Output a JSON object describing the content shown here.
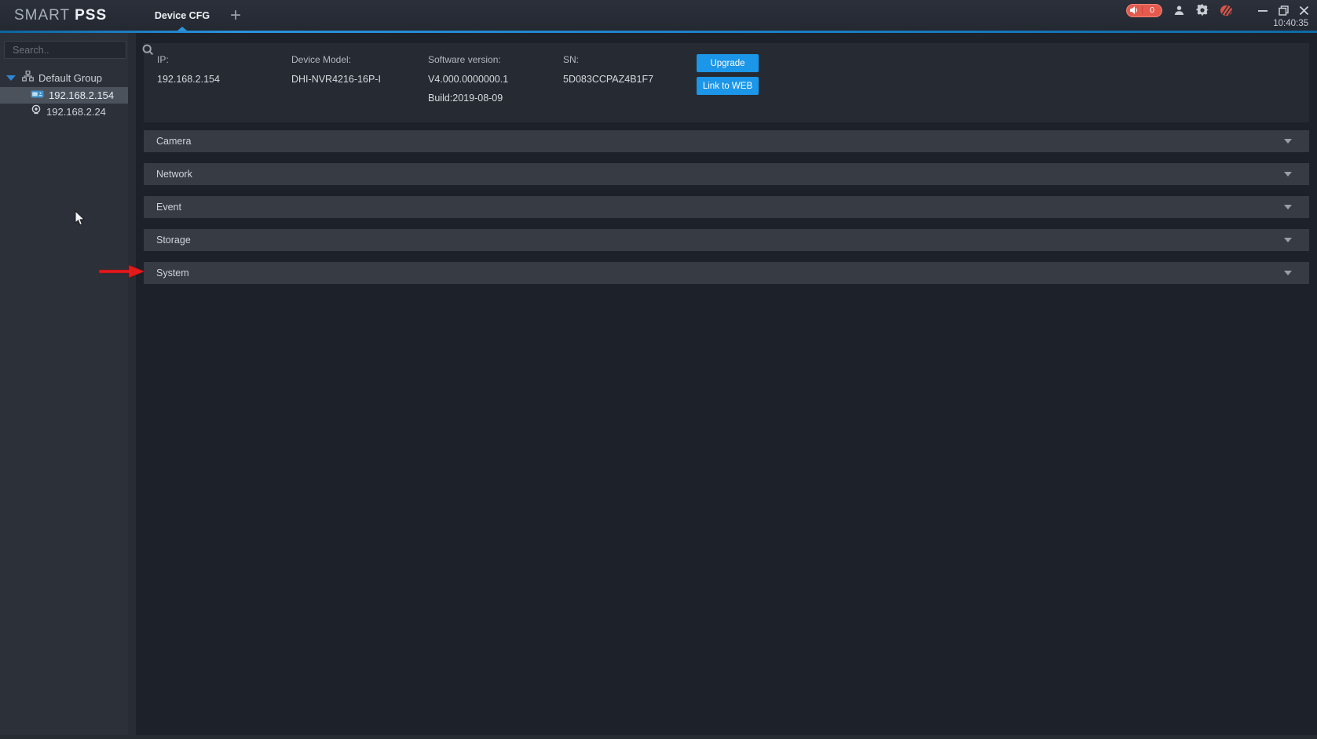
{
  "app": {
    "brand_primary": "SMART",
    "brand_secondary": "PSS",
    "add_tab_label": "+",
    "alarm_count": "0",
    "time": "10:40:35"
  },
  "tabs": [
    {
      "label": "Device CFG",
      "active": true
    }
  ],
  "sidebar": {
    "search_placeholder": "Search..",
    "group_label": "Default Group",
    "devices": [
      {
        "label": "192.168.2.154",
        "icon": "nvr-device-icon",
        "selected": true
      },
      {
        "label": "192.168.2.24",
        "icon": "camera-device-icon",
        "selected": false
      }
    ]
  },
  "device_info": {
    "fields": [
      {
        "label": "IP:",
        "value": "192.168.2.154"
      },
      {
        "label": "Device Model:",
        "value": "DHI-NVR4216-16P-I"
      },
      {
        "label": "Software version:",
        "value": "V4.000.0000000.1",
        "value2": "Build:2019-08-09"
      },
      {
        "label": "SN:",
        "value": "5D083CCPAZ4B1F7"
      }
    ],
    "buttons": [
      {
        "label": "Upgrade"
      },
      {
        "label": "Link to WEB"
      }
    ]
  },
  "sections": [
    {
      "label": "Camera"
    },
    {
      "label": "Network"
    },
    {
      "label": "Event"
    },
    {
      "label": "Storage"
    },
    {
      "label": "System"
    }
  ],
  "colors": {
    "accent_blue": "#1b96e8",
    "topbar_accent_line": "#2b93dd",
    "alarm_red": "#e55a4e",
    "annotation_arrow_red": "#e31a1c",
    "selected_row": "#4c525b",
    "section_bar": "#363b44"
  }
}
